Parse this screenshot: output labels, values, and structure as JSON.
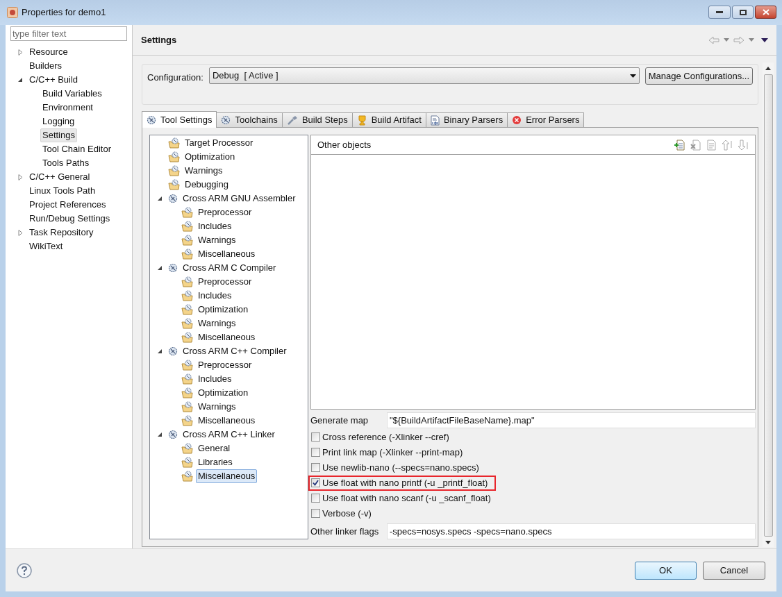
{
  "window": {
    "title": "Properties for demo1"
  },
  "filter": {
    "placeholder": "type filter text"
  },
  "nav": [
    {
      "label": "Resource",
      "expanded": false,
      "selected": false
    },
    {
      "label": "Builders",
      "selected": false
    },
    {
      "label": "C/C++ Build",
      "expanded": true,
      "selected": false,
      "children": [
        {
          "label": "Build Variables",
          "selected": false
        },
        {
          "label": "Environment",
          "selected": false
        },
        {
          "label": "Logging",
          "selected": false
        },
        {
          "label": "Settings",
          "selected": true
        },
        {
          "label": "Tool Chain Editor",
          "selected": false
        },
        {
          "label": "Tools Paths",
          "selected": false
        }
      ]
    },
    {
      "label": "C/C++ General",
      "expanded": false,
      "selected": false
    },
    {
      "label": "Linux Tools Path",
      "selected": false
    },
    {
      "label": "Project References",
      "selected": false
    },
    {
      "label": "Run/Debug Settings",
      "selected": false
    },
    {
      "label": "Task Repository",
      "expanded": false,
      "selected": false
    },
    {
      "label": "WikiText",
      "selected": false
    }
  ],
  "page": {
    "title": "Settings"
  },
  "configuration": {
    "label": "Configuration:",
    "value": "Debug  [ Active ]",
    "manage_button": "Manage Configurations..."
  },
  "tabs": [
    {
      "label": "Tool Settings",
      "kind": "tool",
      "selected": true
    },
    {
      "label": "Toolchains",
      "kind": "tool",
      "selected": false
    },
    {
      "label": "Build Steps",
      "kind": "steps",
      "selected": false
    },
    {
      "label": "Build Artifact",
      "kind": "artifact",
      "selected": false
    },
    {
      "label": "Binary Parsers",
      "kind": "binary",
      "selected": false
    },
    {
      "label": "Error Parsers",
      "kind": "error",
      "selected": false
    }
  ],
  "tool_tree": [
    {
      "label": "Target Processor",
      "kind": "option",
      "selected": false
    },
    {
      "label": "Optimization",
      "kind": "option",
      "selected": false
    },
    {
      "label": "Warnings",
      "kind": "option",
      "selected": false
    },
    {
      "label": "Debugging",
      "kind": "option",
      "selected": false
    },
    {
      "label": "Cross ARM GNU Assembler",
      "kind": "tool",
      "expanded": true,
      "selected": false,
      "children": [
        {
          "label": "Preprocessor",
          "kind": "option",
          "selected": false
        },
        {
          "label": "Includes",
          "kind": "option",
          "selected": false
        },
        {
          "label": "Warnings",
          "kind": "option",
          "selected": false
        },
        {
          "label": "Miscellaneous",
          "kind": "option",
          "selected": false
        }
      ]
    },
    {
      "label": "Cross ARM C Compiler",
      "kind": "tool",
      "expanded": true,
      "selected": false,
      "children": [
        {
          "label": "Preprocessor",
          "kind": "option",
          "selected": false
        },
        {
          "label": "Includes",
          "kind": "option",
          "selected": false
        },
        {
          "label": "Optimization",
          "kind": "option",
          "selected": false
        },
        {
          "label": "Warnings",
          "kind": "option",
          "selected": false
        },
        {
          "label": "Miscellaneous",
          "kind": "option",
          "selected": false
        }
      ]
    },
    {
      "label": "Cross ARM C++ Compiler",
      "kind": "tool",
      "expanded": true,
      "selected": false,
      "children": [
        {
          "label": "Preprocessor",
          "kind": "option",
          "selected": false
        },
        {
          "label": "Includes",
          "kind": "option",
          "selected": false
        },
        {
          "label": "Optimization",
          "kind": "option",
          "selected": false
        },
        {
          "label": "Warnings",
          "kind": "option",
          "selected": false
        },
        {
          "label": "Miscellaneous",
          "kind": "option",
          "selected": false
        }
      ]
    },
    {
      "label": "Cross ARM C++ Linker",
      "kind": "tool",
      "expanded": true,
      "selected": false,
      "children": [
        {
          "label": "General",
          "kind": "option",
          "selected": false
        },
        {
          "label": "Libraries",
          "kind": "option",
          "selected": false
        },
        {
          "label": "Miscellaneous",
          "kind": "option",
          "selected": true
        }
      ]
    }
  ],
  "other_objects": {
    "title": "Other objects"
  },
  "generate_map": {
    "label": "Generate map",
    "value": "\"${BuildArtifactFileBaseName}.map\""
  },
  "options": [
    {
      "label": "Cross reference (-Xlinker --cref)",
      "checked": false,
      "highlighted": false
    },
    {
      "label": "Print link map (-Xlinker --print-map)",
      "checked": false,
      "highlighted": false
    },
    {
      "label": "Use newlib-nano (--specs=nano.specs)",
      "checked": false,
      "highlighted": false
    },
    {
      "label": "Use float with nano printf (-u _printf_float)",
      "checked": true,
      "highlighted": true
    },
    {
      "label": "Use float with nano scanf (-u _scanf_float)",
      "checked": false,
      "highlighted": false
    },
    {
      "label": "Verbose (-v)",
      "checked": false,
      "highlighted": false
    }
  ],
  "other_flags": {
    "label": "Other linker flags",
    "value": "-specs=nosys.specs -specs=nano.specs"
  },
  "buttons": {
    "ok": "OK",
    "cancel": "Cancel"
  }
}
